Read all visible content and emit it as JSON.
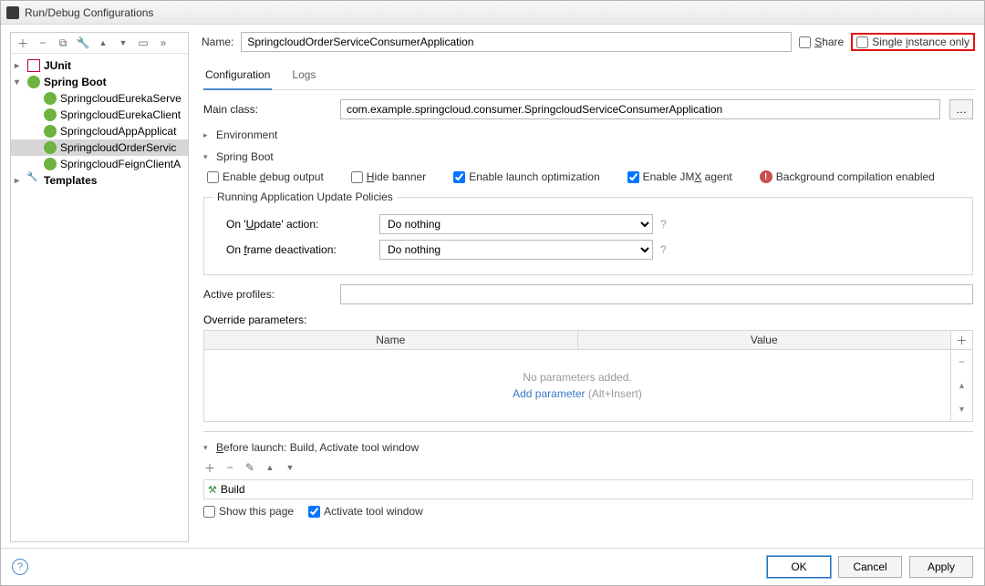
{
  "window": {
    "title": "Run/Debug Configurations"
  },
  "name": {
    "label": "Name:",
    "value": "SpringcloudOrderServiceConsumerApplication"
  },
  "share": {
    "label": "Share",
    "checked": false
  },
  "single_instance": {
    "label": "Single instance only",
    "checked": false
  },
  "sidebar": {
    "nodes": [
      {
        "label": "JUnit",
        "kind": "junit"
      },
      {
        "label": "Spring Boot",
        "kind": "spring"
      },
      {
        "label": "Templates",
        "kind": "wrench"
      }
    ],
    "spring_children": [
      "SpringcloudEurekaServe",
      "SpringcloudEurekaClient",
      "SpringcloudAppApplicat",
      "SpringcloudOrderServic",
      "SpringcloudFeignClientA"
    ]
  },
  "tabs": {
    "configuration": "Configuration",
    "logs": "Logs"
  },
  "main_class": {
    "label": "Main class:",
    "value": "com.example.springcloud.consumer.SpringcloudServiceConsumerApplication"
  },
  "environment": {
    "label": "Environment"
  },
  "spring_boot": {
    "legend": "Spring Boot",
    "enable_debug": "Enable debug output",
    "hide_banner": "Hide banner",
    "enable_launch_opt": "Enable launch optimization",
    "enable_jmx": "Enable JMX agent",
    "bg_compile": "Background compilation enabled",
    "policies_legend": "Running Application Update Policies",
    "on_update_label": "On 'Update' action:",
    "on_frame_label": "On frame deactivation:",
    "do_nothing": "Do nothing"
  },
  "active_profiles": {
    "label": "Active profiles:",
    "value": ""
  },
  "override_params": {
    "label": "Override parameters:",
    "col_name": "Name",
    "col_value": "Value",
    "empty": "No parameters added.",
    "add_link": "Add parameter",
    "add_hint": "(Alt+Insert)"
  },
  "before_launch": {
    "label": "Before launch: Build, Activate tool window",
    "build": "Build",
    "show_page": "Show this page",
    "activate_tw": "Activate tool window"
  },
  "buttons": {
    "ok": "OK",
    "cancel": "Cancel",
    "apply": "Apply"
  }
}
